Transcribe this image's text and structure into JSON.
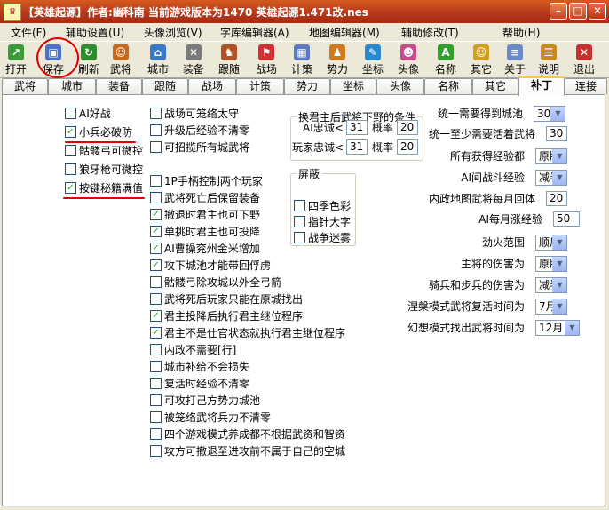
{
  "window": {
    "title": "【英雄起源】作者:幽科南 当前游戏版本为1470  英雄起源1.471改.nes",
    "app_icon": "♛",
    "min": "–",
    "max": "□",
    "close": "✕"
  },
  "menu": [
    "文件(F)",
    "辅助设置(U)",
    "头像浏览(V)",
    "字库编辑器(A)",
    "地图编辑器(M)",
    "辅助修改(T)",
    "帮助(H)"
  ],
  "toolbar": [
    {
      "label": "打开",
      "icon": "folder-open-icon",
      "glyph": "↗",
      "color": "#3b9b3b"
    },
    {
      "label": "保存",
      "icon": "floppy-disk-icon",
      "glyph": "▣",
      "color": "#4a72c8"
    },
    {
      "label": "刷新",
      "icon": "refresh-icon",
      "glyph": "↻",
      "color": "#2e8d2e"
    },
    {
      "label": "武将",
      "icon": "general-icon",
      "glyph": "☺",
      "color": "#c86a1e"
    },
    {
      "label": "城市",
      "icon": "city-icon",
      "glyph": "⌂",
      "color": "#3a78c8"
    },
    {
      "label": "装备",
      "icon": "sword-icon",
      "glyph": "✕",
      "color": "#7a7a7a"
    },
    {
      "label": "跟随",
      "icon": "follow-icon",
      "glyph": "♞",
      "color": "#b0522a"
    },
    {
      "label": "战场",
      "icon": "battlefield-flag-icon",
      "glyph": "⚑",
      "color": "#d03030"
    },
    {
      "label": "计策",
      "icon": "calculator-icon",
      "glyph": "▦",
      "color": "#5a7ac8"
    },
    {
      "label": "势力",
      "icon": "faction-icon",
      "glyph": "♟",
      "color": "#d07a1e"
    },
    {
      "label": "坐标",
      "icon": "coordinate-icon",
      "glyph": "✎",
      "color": "#2a8ad0"
    },
    {
      "label": "头像",
      "icon": "portrait-icon",
      "glyph": "☻",
      "color": "#c84a8a"
    },
    {
      "label": "名称",
      "icon": "letter-a-icon",
      "glyph": "A",
      "color": "#2ea02e"
    },
    {
      "label": "其它",
      "icon": "other-icon",
      "glyph": "☺",
      "color": "#d0a01e"
    },
    {
      "label": "关于",
      "icon": "about-icon",
      "glyph": "≡",
      "color": "#6a8ac8"
    },
    {
      "label": "说明",
      "icon": "help-icon",
      "glyph": "☰",
      "color": "#c88a1e"
    },
    {
      "label": "退出",
      "icon": "exit-icon",
      "glyph": "✕",
      "color": "#c83030"
    }
  ],
  "tabs": [
    "武将",
    "城市",
    "装备",
    "跟随",
    "战场",
    "计策",
    "势力",
    "坐标",
    "头像",
    "名称",
    "其它",
    "补丁",
    "连接"
  ],
  "active_tab_index": 11,
  "col1": [
    {
      "label": "AI好战",
      "checked": false
    },
    {
      "label": "小兵必破防",
      "checked": true
    },
    {
      "label": "骷髅弓可微控",
      "checked": false
    },
    {
      "label": "狼牙枪可微控",
      "checked": false
    },
    {
      "label": "按键秘籍满值",
      "checked": true
    }
  ],
  "col2": [
    {
      "label": "战场可笼络太守",
      "checked": false
    },
    {
      "label": "升级后经验不清零",
      "checked": false
    },
    {
      "label": "可招揽所有城武将",
      "checked": false
    },
    {
      "label": "1P手柄控制两个玩家",
      "checked": false
    },
    {
      "label": "武将死亡后保留装备",
      "checked": false
    },
    {
      "label": "撤退时君主也可下野",
      "checked": true
    },
    {
      "label": "单挑时君主也可投降",
      "checked": true
    },
    {
      "label": "AI曹操兖州金米增加",
      "checked": true
    },
    {
      "label": "攻下城池才能带回俘虏",
      "checked": true
    },
    {
      "label": "骷髅弓除攻城以外全弓箭",
      "checked": false
    },
    {
      "label": "武将死后玩家只能在原城找出",
      "checked": false
    },
    {
      "label": "君主投降后执行君主继位程序",
      "checked": true
    },
    {
      "label": "君主不是仕官状态就执行君主继位程序",
      "checked": true
    },
    {
      "label": "内政不需要[行]",
      "checked": false
    },
    {
      "label": "城市补给不会损失",
      "checked": false
    },
    {
      "label": "复活时经验不清零",
      "checked": false
    },
    {
      "label": "可攻打己方势力城池",
      "checked": false
    },
    {
      "label": "被笼络武将兵力不清零",
      "checked": false
    },
    {
      "label": "四个游戏模式养成都不根据武资和智资",
      "checked": false
    },
    {
      "label": "攻方可撤退至进攻前不属于自己的空城",
      "checked": false
    }
  ],
  "group_defect": {
    "title": "换君主后武将下野的条件",
    "row1": {
      "label": "AI忠诚<",
      "value": "31",
      "rate_label": "概率",
      "rate": "20"
    },
    "row2": {
      "label": "玩家忠诚<",
      "value": "31",
      "rate_label": "概率",
      "rate": "20"
    }
  },
  "group_shield": {
    "title": "屏蔽",
    "items": [
      {
        "label": "四季色彩",
        "checked": false
      },
      {
        "label": "指针大字",
        "checked": false
      },
      {
        "label": "战争迷雾",
        "checked": false
      }
    ]
  },
  "right": [
    {
      "label": "统一需要得到城池",
      "type": "select",
      "value": "30"
    },
    {
      "label": "统一至少需要活着武将",
      "type": "input",
      "value": "30"
    },
    {
      "label": "所有获得经验都",
      "type": "select",
      "value": "原版"
    },
    {
      "label": "AI间战斗经验",
      "type": "select",
      "value": "减半"
    },
    {
      "label": "内政地图武将每月回体",
      "type": "input",
      "value": "20"
    },
    {
      "label": "AI每月涨经验",
      "type": "input",
      "value": "50"
    },
    {
      "label": "劲火范围",
      "type": "select",
      "value": "顺风"
    },
    {
      "label": "主将的伤害为",
      "type": "select",
      "value": "原版"
    },
    {
      "label": "骑兵和步兵的伤害为",
      "type": "select",
      "value": "减半"
    },
    {
      "label": "涅槃模式武将复活时间为",
      "type": "select",
      "value": "7月"
    },
    {
      "label": "幻想模式找出武将时间为",
      "type": "select",
      "value": "12月"
    }
  ],
  "colors": {
    "check": "#21a121",
    "annotation": "#e00000"
  }
}
